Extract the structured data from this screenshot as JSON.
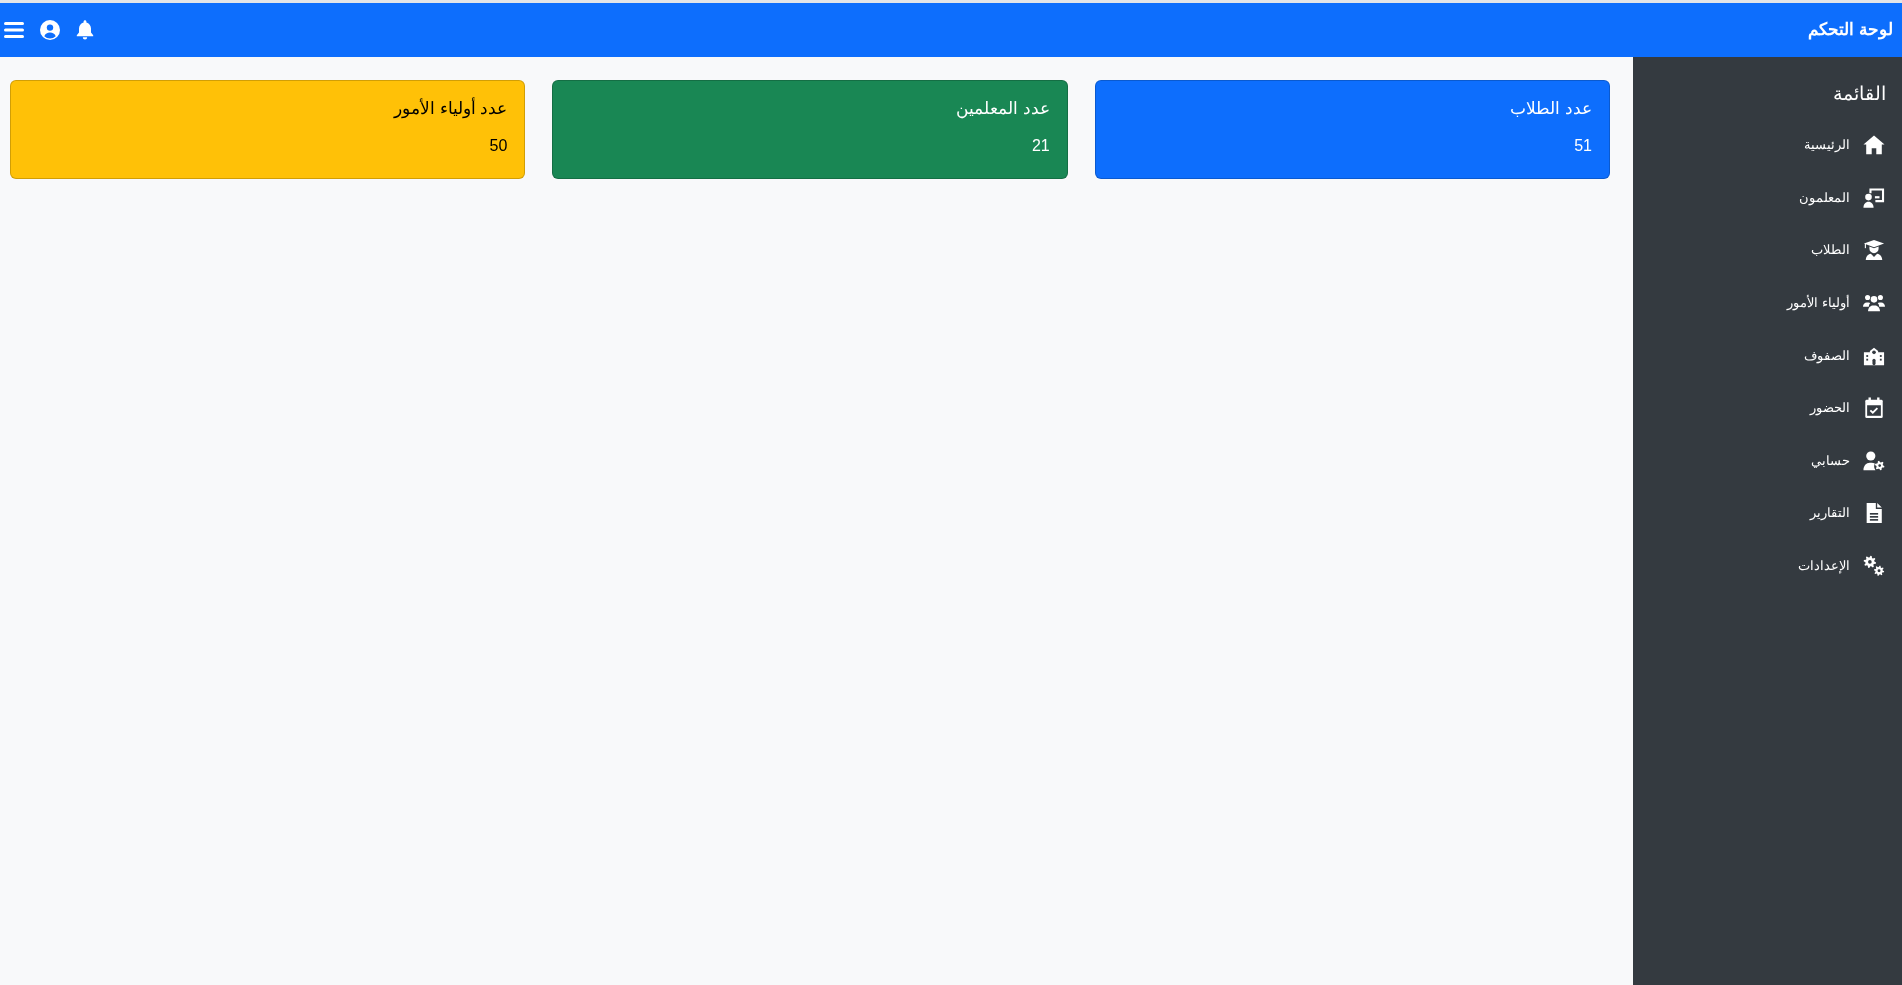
{
  "navbar": {
    "title": "لوحة التحكم"
  },
  "sidebar": {
    "heading": "القائمة",
    "items": [
      {
        "label": "الرئيسية"
      },
      {
        "label": "المعلمون"
      },
      {
        "label": "الطلاب"
      },
      {
        "label": "أولياء الأمور"
      },
      {
        "label": "الصفوف"
      },
      {
        "label": "الحضور"
      },
      {
        "label": "حسابي"
      },
      {
        "label": "التقارير"
      },
      {
        "label": "الإعدادات"
      }
    ]
  },
  "cards": [
    {
      "title": "عدد الطلاب",
      "value": "51",
      "color": "#0d6efd"
    },
    {
      "title": "عدد المعلمين",
      "value": "21",
      "color": "#198754"
    },
    {
      "title": "عدد أولياء الأمور",
      "value": "50",
      "color": "#ffc107"
    }
  ]
}
